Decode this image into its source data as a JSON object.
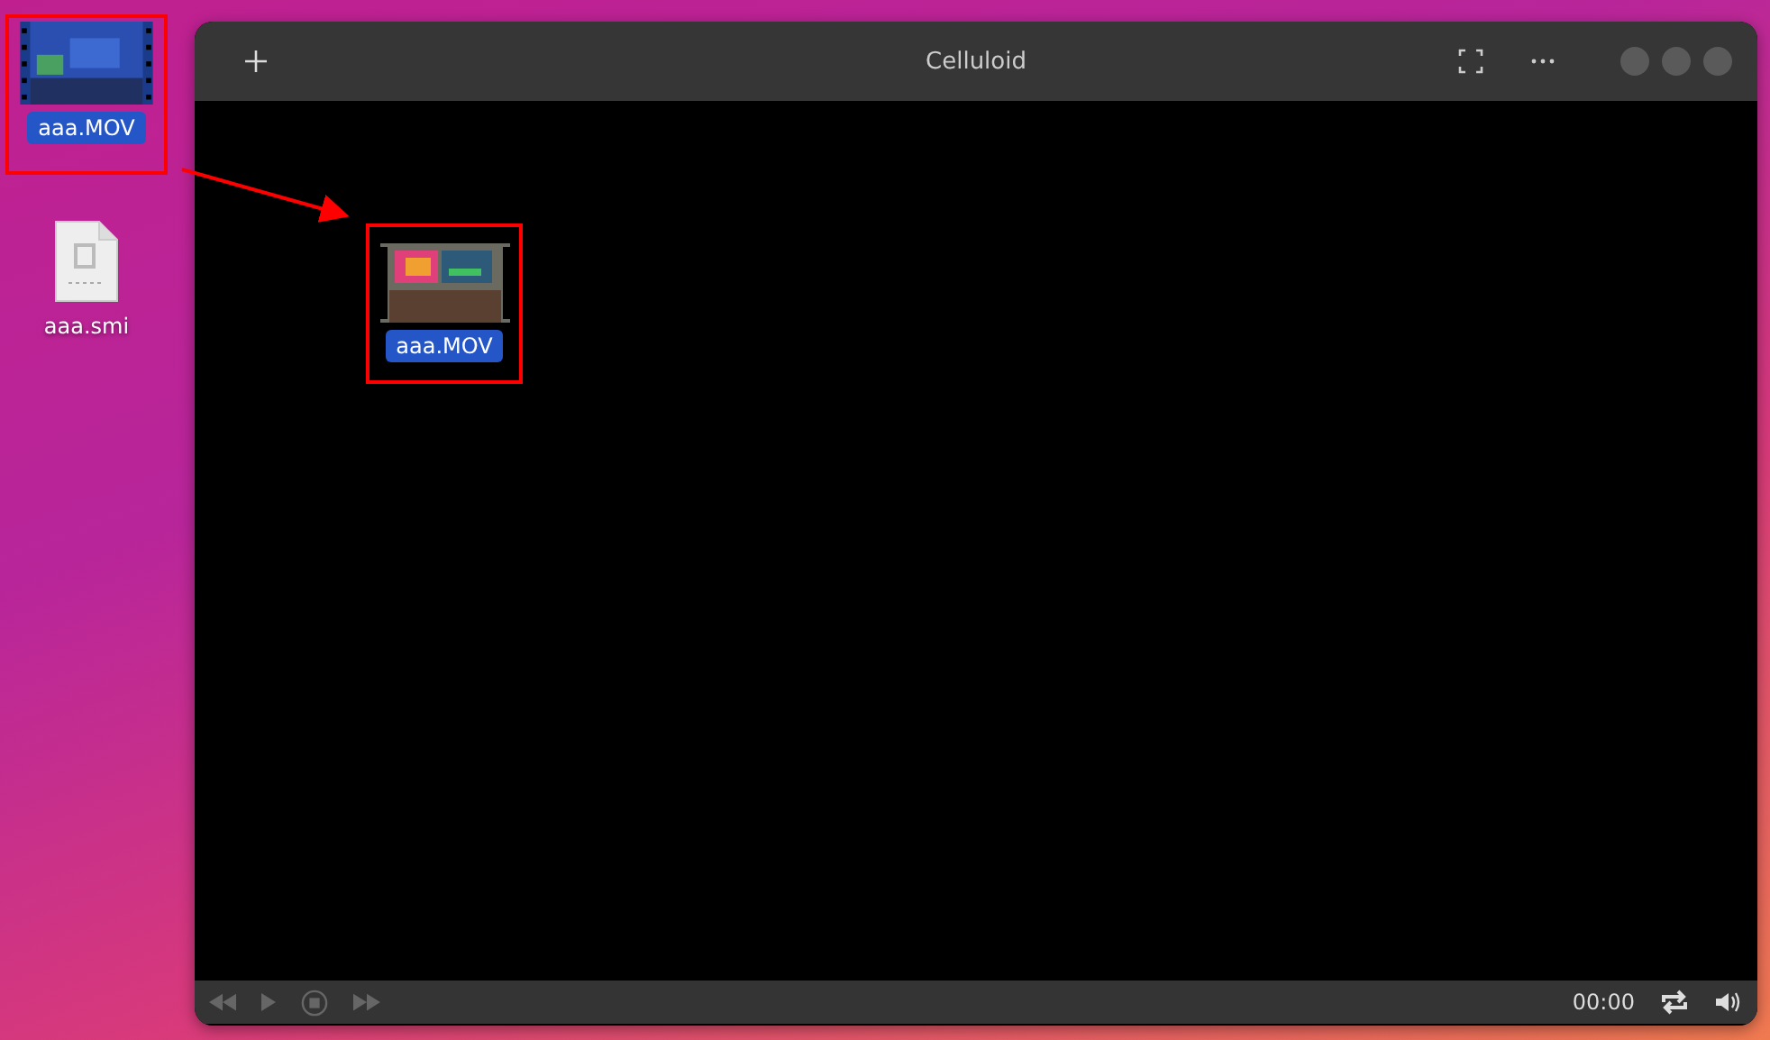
{
  "desktop_icons": [
    {
      "label": "aaa.MOV",
      "kind": "video",
      "selected": true
    },
    {
      "label": "aaa.smi",
      "kind": "subtitle",
      "selected": false
    }
  ],
  "window": {
    "title": "Celluloid"
  },
  "drag_preview": {
    "label": "aaa.MOV"
  },
  "controls": {
    "time": "00:00"
  }
}
